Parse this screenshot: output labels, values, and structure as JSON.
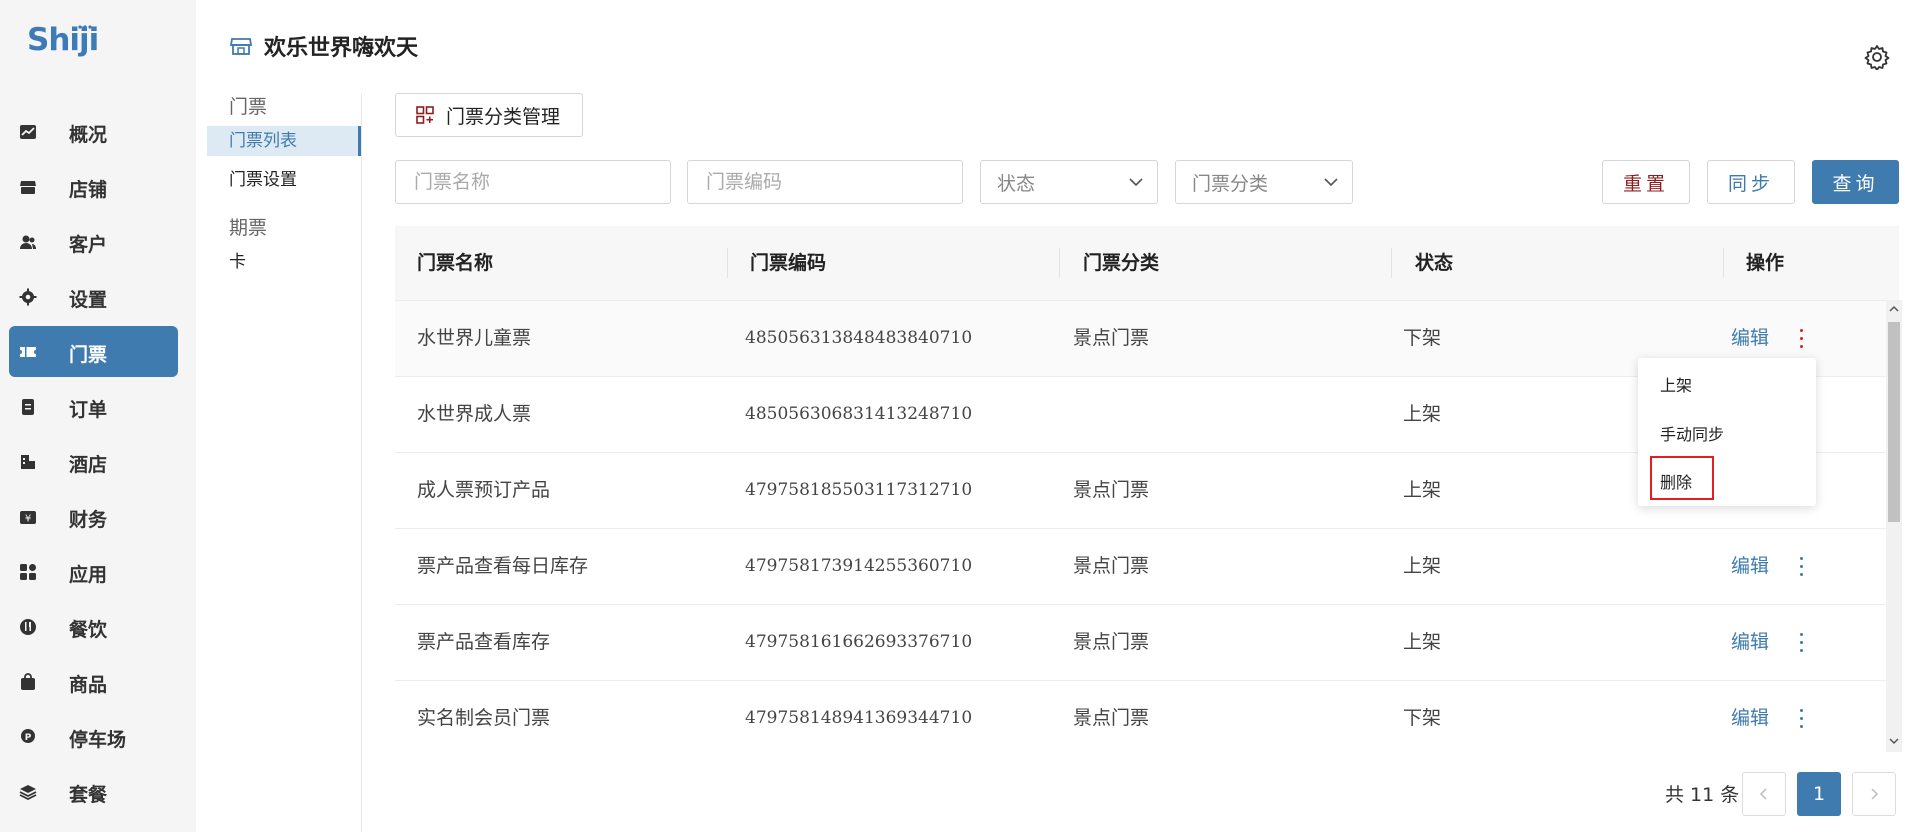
{
  "brand": {
    "logo_text": "Shiji"
  },
  "sidebar": {
    "items": [
      {
        "label": "概况",
        "icon": "chart-icon"
      },
      {
        "label": "店铺",
        "icon": "store-icon"
      },
      {
        "label": "客户",
        "icon": "users-icon"
      },
      {
        "label": "设置",
        "icon": "gear-icon"
      },
      {
        "label": "门票",
        "icon": "ticket-icon",
        "active": true
      },
      {
        "label": "订单",
        "icon": "order-icon"
      },
      {
        "label": "酒店",
        "icon": "hotel-icon"
      },
      {
        "label": "财务",
        "icon": "finance-icon"
      },
      {
        "label": "应用",
        "icon": "apps-icon"
      },
      {
        "label": "餐饮",
        "icon": "dining-icon"
      },
      {
        "label": "商品",
        "icon": "bag-icon"
      },
      {
        "label": "停车场",
        "icon": "parking-icon"
      },
      {
        "label": "套餐",
        "icon": "layers-icon"
      }
    ]
  },
  "header": {
    "title": "欢乐世界嗨欢天"
  },
  "submenu": {
    "group1": "门票",
    "item_list": "门票列表",
    "item_settings": "门票设置",
    "group2": "期票",
    "item_card": "卡"
  },
  "toolbar": {
    "category_button": "门票分类管理"
  },
  "filters": {
    "name_placeholder": "门票名称",
    "code_placeholder": "门票编码",
    "status_label": "状态",
    "category_label": "门票分类",
    "reset": "重置",
    "sync": "同步",
    "query": "查询"
  },
  "table": {
    "columns": [
      "门票名称",
      "门票编码",
      "门票分类",
      "状态",
      "操作"
    ],
    "edit_label": "编辑",
    "rows": [
      {
        "name": "水世界儿童票",
        "code": "485056313848483840710",
        "category": "景点门票",
        "status": "下架"
      },
      {
        "name": "水世界成人票",
        "code": "485056306831413248710",
        "category": "",
        "status": "上架"
      },
      {
        "name": "成人票预订产品",
        "code": "479758185503117312710",
        "category": "景点门票",
        "status": "上架"
      },
      {
        "name": "票产品查看每日库存",
        "code": "479758173914255360710",
        "category": "景点门票",
        "status": "上架"
      },
      {
        "name": "票产品查看库存",
        "code": "479758161662693376710",
        "category": "景点门票",
        "status": "上架"
      },
      {
        "name": "实名制会员门票",
        "code": "479758148941369344710",
        "category": "景点门票",
        "status": "下架"
      }
    ]
  },
  "dropdown": {
    "items": [
      "上架",
      "手动同步",
      "删除"
    ]
  },
  "pagination": {
    "total": "共 11 条",
    "current": "1"
  },
  "colors": {
    "accent": "#3f7bae",
    "danger": "#e02020",
    "reset_text": "#8b1f1f"
  }
}
